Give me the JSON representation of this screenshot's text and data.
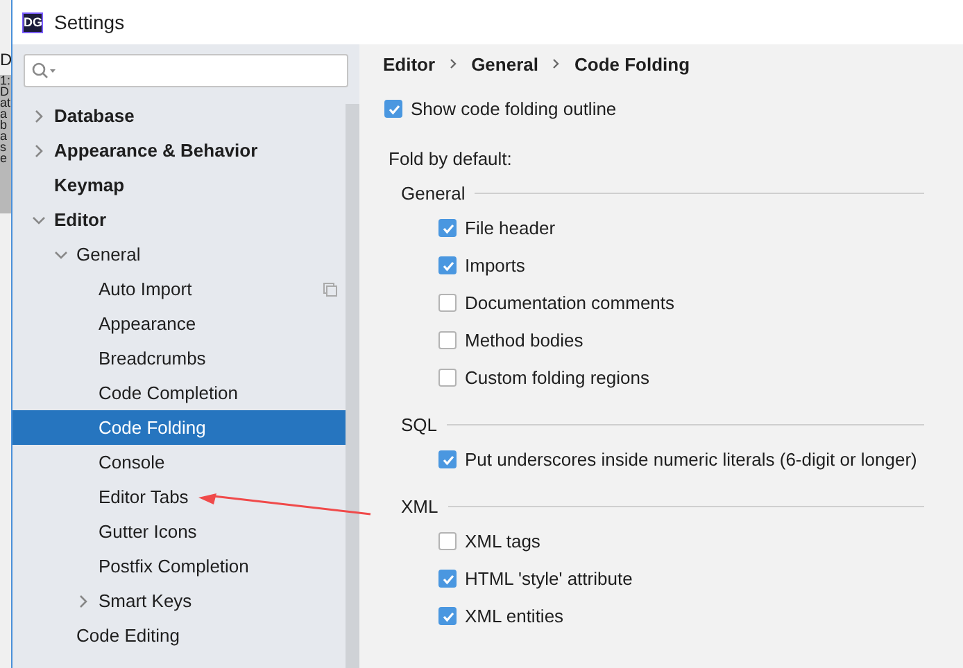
{
  "window": {
    "title": "Settings",
    "app_badge": "DG"
  },
  "background_ide": {
    "tab_letter": "D",
    "side_tab": "1: Database"
  },
  "sidebar": {
    "items": [
      {
        "label": "Database",
        "expanded": false,
        "selected": false
      },
      {
        "label": "Appearance & Behavior",
        "expanded": false,
        "selected": false
      },
      {
        "label": "Keymap",
        "selected": false
      },
      {
        "label": "Editor",
        "expanded": true,
        "selected": false,
        "children": [
          {
            "label": "General",
            "expanded": true,
            "selected": false,
            "children": [
              {
                "label": "Auto Import",
                "selected": false,
                "copy_icon": true
              },
              {
                "label": "Appearance",
                "selected": false
              },
              {
                "label": "Breadcrumbs",
                "selected": false
              },
              {
                "label": "Code Completion",
                "selected": false
              },
              {
                "label": "Code Folding",
                "selected": true
              },
              {
                "label": "Console",
                "selected": false
              },
              {
                "label": "Editor Tabs",
                "selected": false
              },
              {
                "label": "Gutter Icons",
                "selected": false
              },
              {
                "label": "Postfix Completion",
                "selected": false
              },
              {
                "label": "Smart Keys",
                "expanded": false,
                "selected": false
              }
            ]
          },
          {
            "label": "Code Editing",
            "selected": false
          }
        ]
      }
    ]
  },
  "breadcrumb": [
    "Editor",
    "General",
    "Code Folding"
  ],
  "show_outline": {
    "label": "Show code folding outline",
    "checked": true
  },
  "fold_label": "Fold by default:",
  "groups": [
    {
      "title": "General",
      "options": [
        {
          "label": "File header",
          "checked": true
        },
        {
          "label": "Imports",
          "checked": true
        },
        {
          "label": "Documentation comments",
          "checked": false
        },
        {
          "label": "Method bodies",
          "checked": false
        },
        {
          "label": "Custom folding regions",
          "checked": false
        }
      ]
    },
    {
      "title": "SQL",
      "options": [
        {
          "label": "Put underscores inside numeric literals (6-digit or longer)",
          "checked": true
        }
      ]
    },
    {
      "title": "XML",
      "options": [
        {
          "label": "XML tags",
          "checked": false
        },
        {
          "label": "HTML 'style' attribute",
          "checked": true
        },
        {
          "label": "XML entities",
          "checked": true
        }
      ]
    }
  ]
}
